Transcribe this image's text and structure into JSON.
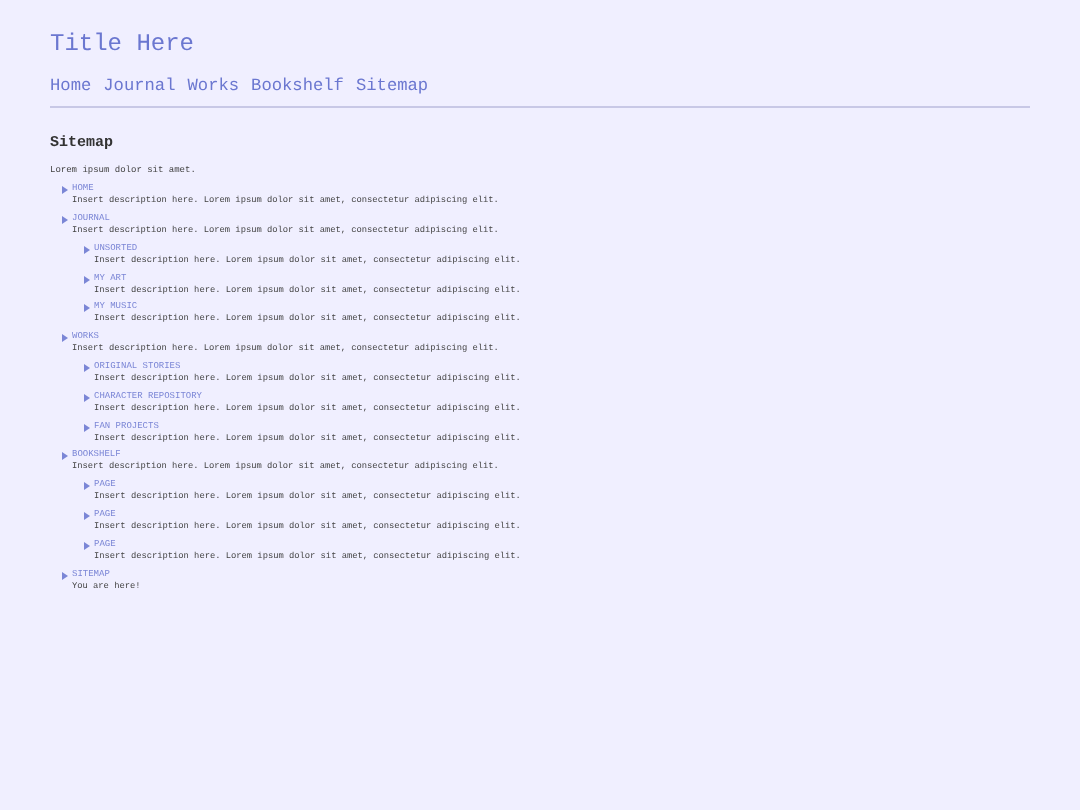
{
  "site_title": "Title Here",
  "nav": [
    "Home",
    "Journal",
    "Works",
    "Bookshelf",
    "Sitemap"
  ],
  "heading": "Sitemap",
  "intro": "Lorem ipsum dolor sit amet.",
  "items": [
    {
      "label": "HOME",
      "description": "Insert description here. Lorem ipsum dolor sit amet, consectetur adipiscing elit."
    },
    {
      "label": "JOURNAL",
      "description": "Insert description here. Lorem ipsum dolor sit amet, consectetur adipiscing elit.",
      "children": [
        {
          "label": "UNSORTED",
          "description": "Insert description here. Lorem ipsum dolor sit amet, consectetur adipiscing elit."
        },
        {
          "label": "MY ART",
          "description": "Insert description here. Lorem ipsum dolor sit amet, consectetur adipiscing elit."
        },
        {
          "label": "MY MUSIC",
          "description": "Insert description here. Lorem ipsum dolor sit amet, consectetur adipiscing elit."
        }
      ]
    },
    {
      "label": "WORKS",
      "description": "Insert description here. Lorem ipsum dolor sit amet, consectetur adipiscing elit.",
      "children": [
        {
          "label": "ORIGINAL STORIES",
          "description": "Insert description here. Lorem ipsum dolor sit amet, consectetur adipiscing elit."
        },
        {
          "label": "CHARACTER REPOSITORY",
          "description": "Insert description here. Lorem ipsum dolor sit amet, consectetur adipiscing elit."
        },
        {
          "label": "FAN PROJECTS",
          "description": "Insert description here. Lorem ipsum dolor sit amet, consectetur adipiscing elit."
        }
      ]
    },
    {
      "label": "BOOKSHELF",
      "description": "Insert description here. Lorem ipsum dolor sit amet, consectetur adipiscing elit.",
      "children": [
        {
          "label": "PAGE",
          "description": "Insert description here. Lorem ipsum dolor sit amet, consectetur adipiscing elit."
        },
        {
          "label": "PAGE",
          "description": "Insert description here. Lorem ipsum dolor sit amet, consectetur adipiscing elit."
        },
        {
          "label": "PAGE",
          "description": "Insert description here. Lorem ipsum dolor sit amet, consectetur adipiscing elit."
        }
      ]
    },
    {
      "label": "SITEMAP",
      "description": "You are here!"
    }
  ]
}
